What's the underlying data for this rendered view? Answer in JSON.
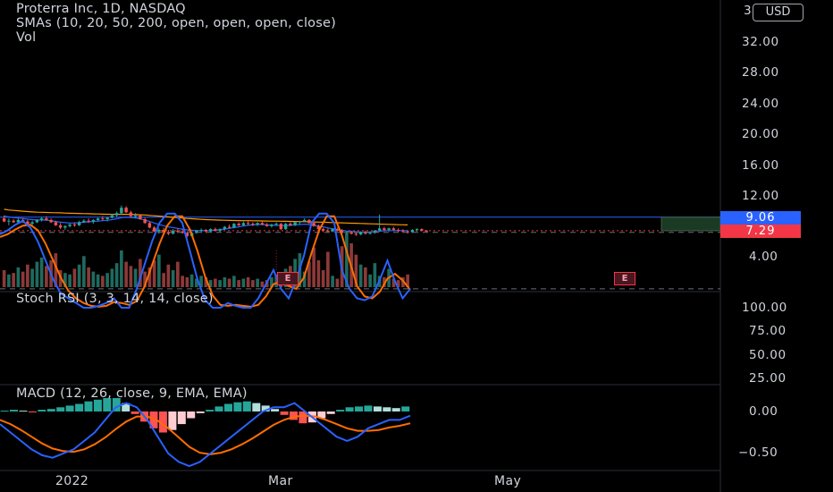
{
  "header": {
    "title": "Proterra Inc, 1D, NASDAQ",
    "sma_legend": "SMAs (10, 20, 50, 200, open, open, open, close)",
    "vol_legend": "Vol",
    "currency": "USD"
  },
  "price_axis": {
    "ticks": [
      "32.00",
      "28.00",
      "24.00",
      "20.00",
      "16.00",
      "12.00",
      "4.00"
    ],
    "top_cut_label": "3",
    "tags": {
      "blue": "9.06",
      "red": "7.29"
    }
  },
  "stoch_panel": {
    "legend": "Stoch RSI (3, 3, 14, 14, close)",
    "ticks": [
      "100.00",
      "75.00",
      "50.00",
      "25.00"
    ]
  },
  "macd_panel": {
    "legend": "MACD (12, 26, close, 9, EMA, EMA)",
    "ticks": [
      "0.00",
      "−0.50"
    ]
  },
  "time_axis": {
    "labels": [
      "2022",
      "Mar",
      "May"
    ]
  },
  "earnings": {
    "label": "E"
  },
  "colors": {
    "up": "#26a69a",
    "down": "#ef5350",
    "volume_up": "#1e6b5f",
    "volume_down": "#8c3a38",
    "stoch_k": "#2962ff",
    "stoch_d": "#ff6d00",
    "macd": "#2962ff",
    "signal": "#ff6d00",
    "tag_blue": "#2962ff",
    "tag_red": "#f23645"
  },
  "chart_data": {
    "type": "line",
    "candles": [
      {
        "o": 8.9,
        "h": 9.3,
        "l": 8.4,
        "c": 8.5
      },
      {
        "o": 8.5,
        "h": 8.9,
        "l": 8.0,
        "c": 8.6
      },
      {
        "o": 8.6,
        "h": 8.8,
        "l": 8.3,
        "c": 8.4
      },
      {
        "o": 8.4,
        "h": 8.9,
        "l": 8.2,
        "c": 8.7
      },
      {
        "o": 8.7,
        "h": 8.9,
        "l": 8.3,
        "c": 8.5
      },
      {
        "o": 8.5,
        "h": 8.7,
        "l": 8.1,
        "c": 8.2
      },
      {
        "o": 8.2,
        "h": 8.6,
        "l": 7.9,
        "c": 8.4
      },
      {
        "o": 8.4,
        "h": 8.8,
        "l": 8.3,
        "c": 8.7
      },
      {
        "o": 8.7,
        "h": 9.1,
        "l": 8.5,
        "c": 8.9
      },
      {
        "o": 8.9,
        "h": 9.2,
        "l": 8.6,
        "c": 8.7
      },
      {
        "o": 8.7,
        "h": 8.9,
        "l": 8.3,
        "c": 8.4
      },
      {
        "o": 8.4,
        "h": 8.6,
        "l": 7.9,
        "c": 8.0
      },
      {
        "o": 8.0,
        "h": 8.3,
        "l": 7.5,
        "c": 7.7
      },
      {
        "o": 7.7,
        "h": 8.0,
        "l": 7.4,
        "c": 7.9
      },
      {
        "o": 7.9,
        "h": 8.3,
        "l": 7.7,
        "c": 8.1
      },
      {
        "o": 8.1,
        "h": 8.4,
        "l": 7.8,
        "c": 8.0
      },
      {
        "o": 8.0,
        "h": 8.6,
        "l": 7.9,
        "c": 8.4
      },
      {
        "o": 8.4,
        "h": 8.8,
        "l": 8.3,
        "c": 8.6
      },
      {
        "o": 8.6,
        "h": 8.9,
        "l": 8.3,
        "c": 8.5
      },
      {
        "o": 8.5,
        "h": 8.8,
        "l": 8.2,
        "c": 8.7
      },
      {
        "o": 8.7,
        "h": 9.0,
        "l": 8.5,
        "c": 8.9
      },
      {
        "o": 8.9,
        "h": 9.2,
        "l": 8.6,
        "c": 8.8
      },
      {
        "o": 8.8,
        "h": 9.1,
        "l": 8.5,
        "c": 9.0
      },
      {
        "o": 9.0,
        "h": 9.5,
        "l": 8.9,
        "c": 9.3
      },
      {
        "o": 9.3,
        "h": 9.8,
        "l": 9.1,
        "c": 9.6
      },
      {
        "o": 9.6,
        "h": 10.6,
        "l": 9.4,
        "c": 10.3
      },
      {
        "o": 10.3,
        "h": 10.5,
        "l": 9.6,
        "c": 9.7
      },
      {
        "o": 9.7,
        "h": 9.9,
        "l": 9.0,
        "c": 9.2
      },
      {
        "o": 9.2,
        "h": 9.6,
        "l": 8.9,
        "c": 9.3
      },
      {
        "o": 9.3,
        "h": 9.4,
        "l": 8.7,
        "c": 8.8
      },
      {
        "o": 8.8,
        "h": 9.0,
        "l": 8.2,
        "c": 8.3
      },
      {
        "o": 8.3,
        "h": 8.5,
        "l": 7.6,
        "c": 7.7
      },
      {
        "o": 7.7,
        "h": 7.9,
        "l": 7.1,
        "c": 7.2
      },
      {
        "o": 7.2,
        "h": 7.6,
        "l": 6.9,
        "c": 7.4
      },
      {
        "o": 7.4,
        "h": 7.7,
        "l": 7.0,
        "c": 7.1
      },
      {
        "o": 7.1,
        "h": 7.4,
        "l": 6.7,
        "c": 6.9
      },
      {
        "o": 6.9,
        "h": 7.5,
        "l": 6.8,
        "c": 7.3
      },
      {
        "o": 7.3,
        "h": 7.6,
        "l": 7.0,
        "c": 7.2
      },
      {
        "o": 7.2,
        "h": 7.5,
        "l": 6.9,
        "c": 7.0
      },
      {
        "o": 7.0,
        "h": 7.2,
        "l": 6.4,
        "c": 6.6
      },
      {
        "o": 6.6,
        "h": 7.2,
        "l": 6.5,
        "c": 7.0
      },
      {
        "o": 7.0,
        "h": 7.4,
        "l": 6.9,
        "c": 7.3
      },
      {
        "o": 7.3,
        "h": 7.6,
        "l": 7.1,
        "c": 7.4
      },
      {
        "o": 7.4,
        "h": 7.5,
        "l": 7.0,
        "c": 7.2
      },
      {
        "o": 7.2,
        "h": 7.6,
        "l": 7.1,
        "c": 7.5
      },
      {
        "o": 7.5,
        "h": 7.7,
        "l": 7.2,
        "c": 7.3
      },
      {
        "o": 7.3,
        "h": 7.6,
        "l": 7.1,
        "c": 7.5
      },
      {
        "o": 7.5,
        "h": 7.9,
        "l": 7.4,
        "c": 7.8
      },
      {
        "o": 7.8,
        "h": 8.1,
        "l": 7.6,
        "c": 7.7
      },
      {
        "o": 7.7,
        "h": 8.3,
        "l": 7.6,
        "c": 8.2
      },
      {
        "o": 8.2,
        "h": 8.4,
        "l": 7.9,
        "c": 8.0
      },
      {
        "o": 8.0,
        "h": 8.5,
        "l": 7.9,
        "c": 8.3
      },
      {
        "o": 8.3,
        "h": 8.6,
        "l": 8.0,
        "c": 8.2
      },
      {
        "o": 8.2,
        "h": 8.4,
        "l": 7.9,
        "c": 8.1
      },
      {
        "o": 8.1,
        "h": 8.4,
        "l": 7.9,
        "c": 8.3
      },
      {
        "o": 8.3,
        "h": 8.5,
        "l": 8.0,
        "c": 8.1
      },
      {
        "o": 8.1,
        "h": 8.3,
        "l": 7.8,
        "c": 7.9
      },
      {
        "o": 7.9,
        "h": 8.2,
        "l": 7.7,
        "c": 8.1
      },
      {
        "o": 8.1,
        "h": 8.4,
        "l": 7.9,
        "c": 8.2
      },
      {
        "o": 8.2,
        "h": 8.3,
        "l": 7.4,
        "c": 7.5
      },
      {
        "o": 7.5,
        "h": 8.3,
        "l": 7.4,
        "c": 8.2
      },
      {
        "o": 8.2,
        "h": 8.4,
        "l": 7.9,
        "c": 8.0
      },
      {
        "o": 8.0,
        "h": 8.5,
        "l": 7.9,
        "c": 8.4
      },
      {
        "o": 8.4,
        "h": 8.6,
        "l": 8.1,
        "c": 8.5
      },
      {
        "o": 8.5,
        "h": 8.9,
        "l": 8.4,
        "c": 8.7
      },
      {
        "o": 8.7,
        "h": 8.8,
        "l": 8.2,
        "c": 8.3
      },
      {
        "o": 8.3,
        "h": 8.5,
        "l": 7.8,
        "c": 7.9
      },
      {
        "o": 7.9,
        "h": 8.1,
        "l": 7.4,
        "c": 7.5
      },
      {
        "o": 7.5,
        "h": 7.7,
        "l": 7.1,
        "c": 7.3
      },
      {
        "o": 7.3,
        "h": 7.6,
        "l": 7.0,
        "c": 7.2
      },
      {
        "o": 7.2,
        "h": 7.6,
        "l": 7.1,
        "c": 7.5
      },
      {
        "o": 7.5,
        "h": 7.7,
        "l": 7.2,
        "c": 7.3
      },
      {
        "o": 7.3,
        "h": 7.5,
        "l": 6.9,
        "c": 7.0
      },
      {
        "o": 7.0,
        "h": 7.2,
        "l": 6.8,
        "c": 7.1
      },
      {
        "o": 7.1,
        "h": 7.3,
        "l": 6.8,
        "c": 6.9
      },
      {
        "o": 6.9,
        "h": 7.1,
        "l": 6.6,
        "c": 6.8
      },
      {
        "o": 6.8,
        "h": 7.2,
        "l": 6.7,
        "c": 7.1
      },
      {
        "o": 7.1,
        "h": 7.3,
        "l": 6.8,
        "c": 6.9
      },
      {
        "o": 6.9,
        "h": 7.2,
        "l": 6.8,
        "c": 7.0
      },
      {
        "o": 7.0,
        "h": 7.4,
        "l": 6.9,
        "c": 7.3
      },
      {
        "o": 7.3,
        "h": 9.4,
        "l": 7.2,
        "c": 7.6
      },
      {
        "o": 7.6,
        "h": 7.8,
        "l": 7.2,
        "c": 7.4
      },
      {
        "o": 7.4,
        "h": 7.7,
        "l": 7.2,
        "c": 7.6
      },
      {
        "o": 7.6,
        "h": 7.8,
        "l": 7.3,
        "c": 7.4
      },
      {
        "o": 7.4,
        "h": 7.6,
        "l": 7.1,
        "c": 7.3
      },
      {
        "o": 7.3,
        "h": 7.5,
        "l": 7.0,
        "c": 7.2
      },
      {
        "o": 7.2,
        "h": 7.3,
        "l": 6.9,
        "c": 7.1
      },
      {
        "o": 7.1,
        "h": 7.5,
        "l": 7.0,
        "c": 7.4
      },
      {
        "o": 7.4,
        "h": 7.6,
        "l": 7.2,
        "c": 7.5
      },
      {
        "o": 7.5,
        "h": 7.6,
        "l": 7.2,
        "c": 7.3
      },
      {
        "o": 7.3,
        "h": 7.4,
        "l": 7.1,
        "c": 7.29
      }
    ],
    "volume": [
      1.2,
      0.9,
      1.0,
      1.4,
      1.1,
      1.6,
      1.3,
      1.8,
      2.1,
      1.5,
      1.9,
      2.4,
      1.2,
      1.0,
      0.9,
      1.3,
      1.6,
      2.2,
      1.4,
      1.1,
      0.9,
      0.8,
      1.0,
      1.3,
      1.7,
      2.6,
      1.8,
      1.5,
      1.3,
      2.0,
      1.1,
      1.4,
      1.9,
      2.3,
      1.0,
      1.6,
      1.2,
      1.8,
      0.8,
      0.7,
      0.9,
      0.6,
      0.8,
      0.7,
      0.5,
      0.6,
      0.5,
      0.7,
      0.6,
      0.8,
      0.5,
      0.6,
      0.7,
      0.5,
      0.6,
      0.4,
      0.5,
      0.7,
      0.9,
      1.0,
      1.3,
      1.5,
      2.0,
      2.4,
      1.1,
      1.8,
      2.8,
      1.9,
      1.2,
      2.5,
      0.8,
      0.6,
      2.9,
      3.8,
      3.1,
      2.3,
      1.6,
      1.4,
      0.9,
      1.7,
      0.8,
      0.7,
      1.3,
      0.6,
      0.5,
      0.7,
      0.9
    ],
    "sma_orange": [
      10.1,
      10.0,
      9.95,
      9.9,
      9.85,
      9.8,
      9.75,
      9.72,
      9.7,
      9.68,
      9.66,
      9.65,
      9.63,
      9.6,
      9.58,
      9.56,
      9.55,
      9.53,
      9.52,
      9.5,
      9.48,
      9.46,
      9.45,
      9.44,
      9.43,
      9.45,
      9.44,
      9.42,
      9.4,
      9.38,
      9.35,
      9.3,
      9.25,
      9.2,
      9.15,
      9.1,
      9.05,
      9.0,
      8.95,
      8.9,
      8.86,
      8.82,
      8.78,
      8.75,
      8.72,
      8.7,
      8.68,
      8.66,
      8.64,
      8.63,
      8.62,
      8.61,
      8.6,
      8.59,
      8.58,
      8.57,
      8.56,
      8.55,
      8.54,
      8.53,
      8.52,
      8.51,
      8.5,
      8.49,
      8.48,
      8.46,
      8.44,
      8.42,
      8.4,
      8.38,
      8.36,
      8.34,
      8.32,
      8.3,
      8.28,
      8.26,
      8.24,
      8.22,
      8.2,
      8.18,
      8.16,
      8.14,
      8.12,
      8.1,
      8.08,
      8.06,
      8.05
    ],
    "sma_blue": [
      9.2,
      9.1,
      9.0,
      8.95,
      8.9,
      8.8,
      8.75,
      8.7,
      8.7,
      8.68,
      8.6,
      8.5,
      8.4,
      8.35,
      8.3,
      8.3,
      8.35,
      8.4,
      8.45,
      8.5,
      8.55,
      8.6,
      8.65,
      8.75,
      8.85,
      9.0,
      9.05,
      9.0,
      8.95,
      8.85,
      8.7,
      8.5,
      8.3,
      8.1,
      7.95,
      7.8,
      7.7,
      7.6,
      7.5,
      7.4,
      7.35,
      7.3,
      7.3,
      7.3,
      7.32,
      7.35,
      7.4,
      7.5,
      7.6,
      7.7,
      7.8,
      7.9,
      8.0,
      8.05,
      8.1,
      8.1,
      8.05,
      8.0,
      8.0,
      7.95,
      7.95,
      8.0,
      8.05,
      8.1,
      8.15,
      8.1,
      8.0,
      7.9,
      7.8,
      7.65,
      7.55,
      7.45,
      7.35,
      7.25,
      7.2,
      7.15,
      7.1,
      7.1,
      7.1,
      7.15,
      7.2,
      7.3,
      7.3,
      7.3,
      7.3,
      7.3,
      7.3
    ],
    "stoch_k": [
      22,
      18,
      12,
      8,
      15,
      30,
      50,
      70,
      85,
      90,
      95,
      100,
      100,
      98,
      95,
      90,
      100,
      100,
      80,
      55,
      30,
      10,
      0,
      0,
      10,
      40,
      70,
      92,
      100,
      100,
      95,
      98,
      100,
      100,
      90,
      75,
      60,
      80,
      90,
      70,
      45,
      10,
      0,
      0,
      10,
      60,
      80,
      90,
      92,
      88,
      70,
      50,
      72,
      90,
      80
    ],
    "stoch_d": [
      25,
      22,
      17,
      13,
      12,
      18,
      32,
      50,
      68,
      82,
      90,
      95,
      98,
      99,
      98,
      94,
      95,
      97,
      93,
      78,
      55,
      32,
      13,
      3,
      3,
      17,
      40,
      67,
      87,
      97,
      98,
      97,
      98,
      99,
      97,
      88,
      75,
      72,
      77,
      80,
      68,
      42,
      18,
      3,
      3,
      23,
      50,
      77,
      88,
      90,
      83,
      69,
      64,
      71,
      81
    ],
    "macd_line": [
      -0.15,
      -0.25,
      -0.35,
      -0.45,
      -0.52,
      -0.55,
      -0.5,
      -0.45,
      -0.35,
      -0.25,
      -0.1,
      0.05,
      0.1,
      0.05,
      -0.1,
      -0.3,
      -0.5,
      -0.6,
      -0.65,
      -0.6,
      -0.5,
      -0.4,
      -0.3,
      -0.2,
      -0.1,
      0.0,
      0.05,
      0.05,
      0.1,
      0.0,
      -0.1,
      -0.2,
      -0.3,
      -0.35,
      -0.3,
      -0.2,
      -0.15,
      -0.1,
      -0.1,
      -0.05
    ],
    "signal_line": [
      -0.1,
      -0.15,
      -0.22,
      -0.3,
      -0.38,
      -0.44,
      -0.47,
      -0.48,
      -0.45,
      -0.39,
      -0.31,
      -0.21,
      -0.12,
      -0.06,
      -0.06,
      -0.11,
      -0.2,
      -0.31,
      -0.42,
      -0.49,
      -0.51,
      -0.49,
      -0.45,
      -0.39,
      -0.32,
      -0.24,
      -0.16,
      -0.1,
      -0.06,
      -0.05,
      -0.06,
      -0.1,
      -0.15,
      -0.2,
      -0.23,
      -0.23,
      -0.22,
      -0.19,
      -0.17,
      -0.14
    ],
    "macd_hist": [
      0.01,
      0.02,
      0.01,
      -0.01,
      0.02,
      0.03,
      0.05,
      0.07,
      0.09,
      0.12,
      0.14,
      0.16,
      0.16,
      0.1,
      -0.03,
      -0.12,
      -0.2,
      -0.25,
      -0.22,
      -0.15,
      -0.08,
      -0.02,
      0.02,
      0.06,
      0.09,
      0.11,
      0.12,
      0.1,
      0.07,
      0.03,
      -0.04,
      -0.1,
      -0.14,
      -0.13,
      -0.08,
      -0.03,
      0.02,
      0.05,
      0.06,
      0.07,
      0.06,
      0.05,
      0.04,
      0.06
    ],
    "xlim_bars": [
      0,
      87
    ],
    "price_ylim": [
      2,
      34
    ],
    "stoch_ylim": [
      20,
      105
    ],
    "macd_ylim": [
      -0.7,
      0.15
    ],
    "blue_level": 9.06,
    "red_level": 7.29,
    "earnings_bars": [
      58
    ]
  }
}
